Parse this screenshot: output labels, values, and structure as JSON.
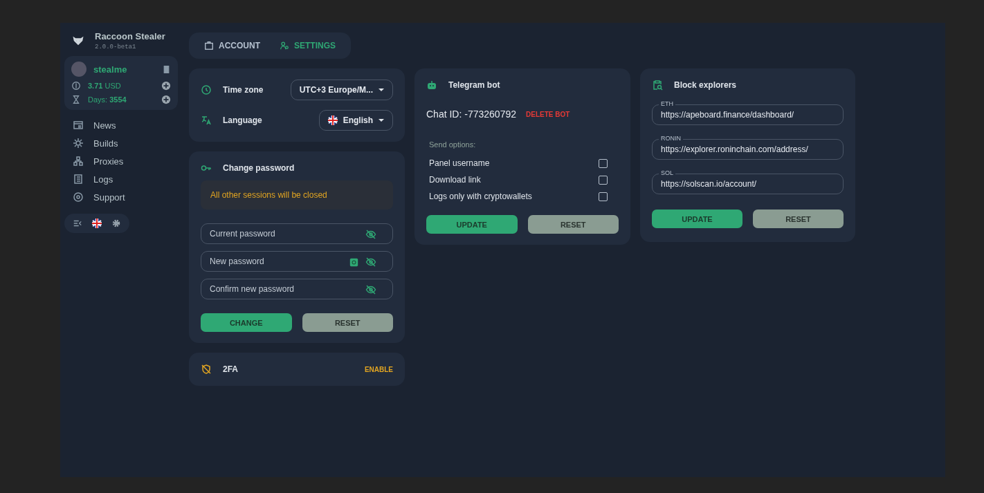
{
  "app": {
    "name": "Raccoon Stealer",
    "version": "2.0.0-beta1"
  },
  "user": {
    "name": "stealme",
    "balance": "3.71",
    "currency": "USD",
    "days_label": "Days:",
    "days": "3554"
  },
  "nav": [
    {
      "label": "News"
    },
    {
      "label": "Builds"
    },
    {
      "label": "Proxies"
    },
    {
      "label": "Logs"
    },
    {
      "label": "Support"
    }
  ],
  "tabs": [
    {
      "label": "ACCOUNT",
      "selected": false
    },
    {
      "label": "SETTINGS",
      "selected": true
    }
  ],
  "preferences": {
    "timezone_label": "Time zone",
    "timezone": "UTC+3 Europe/M...",
    "language_label": "Language",
    "language": "English"
  },
  "password": {
    "title": "Change password",
    "warning": "All other sessions will be closed",
    "fields": [
      {
        "placeholder": "Current password",
        "generate": false
      },
      {
        "placeholder": "New password",
        "generate": true
      },
      {
        "placeholder": "Confirm new password",
        "generate": false
      }
    ],
    "buttons": [
      "CHANGE",
      "RESET"
    ]
  },
  "twofa": {
    "title": "2FA",
    "action": "ENABLE"
  },
  "telegram": {
    "title": "Telegram bot",
    "chat_label": "Chat ID:",
    "chat_id": "-773260792",
    "delete": "DELETE BOT",
    "options_label": "Send options:",
    "options": [
      {
        "label": "Panel username",
        "checked": false
      },
      {
        "label": "Download link",
        "checked": false
      },
      {
        "label": "Logs only with cryptowallets",
        "checked": false
      }
    ],
    "buttons": [
      "UPDATE",
      "RESET"
    ]
  },
  "explorers": {
    "title": "Block explorers",
    "fields": [
      {
        "label": "ETH",
        "value": "https://apeboard.finance/dashboard/"
      },
      {
        "label": "RONIN",
        "value": "https://explorer.roninchain.com/address/"
      },
      {
        "label": "SOL",
        "value": "https://solscan.io/account/"
      }
    ],
    "buttons": [
      "UPDATE",
      "RESET"
    ]
  }
}
